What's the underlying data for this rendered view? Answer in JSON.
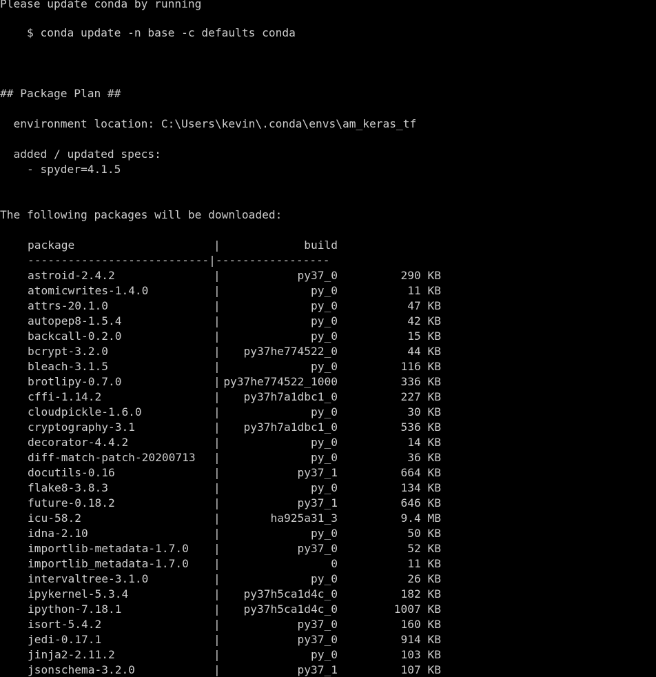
{
  "terminal": {
    "intro": "Please update conda by running",
    "update_command": "    $ conda update -n base -c defaults conda",
    "plan_heading": "## Package Plan ##",
    "env_location": "  environment location: C:\\Users\\kevin\\.conda\\envs\\am_keras_tf",
    "specs_heading": "  added / updated specs:",
    "spec_item": "    - spyder=4.1.5",
    "download_heading": "The following packages will be downloaded:",
    "table": {
      "header_package": "package",
      "header_sep": "|",
      "header_build": "build",
      "divider": "---------------------------|-----------------"
    },
    "packages": [
      {
        "name": "astroid-2.4.2",
        "build": "py37_0",
        "size": "290 KB"
      },
      {
        "name": "atomicwrites-1.4.0",
        "build": "py_0",
        "size": "11 KB"
      },
      {
        "name": "attrs-20.1.0",
        "build": "py_0",
        "size": "47 KB"
      },
      {
        "name": "autopep8-1.5.4",
        "build": "py_0",
        "size": "42 KB"
      },
      {
        "name": "backcall-0.2.0",
        "build": "py_0",
        "size": "15 KB"
      },
      {
        "name": "bcrypt-3.2.0",
        "build": "py37he774522_0",
        "size": "44 KB"
      },
      {
        "name": "bleach-3.1.5",
        "build": "py_0",
        "size": "116 KB"
      },
      {
        "name": "brotlipy-0.7.0",
        "build": "py37he774522_1000",
        "size": "336 KB"
      },
      {
        "name": "cffi-1.14.2",
        "build": "py37h7a1dbc1_0",
        "size": "227 KB"
      },
      {
        "name": "cloudpickle-1.6.0",
        "build": "py_0",
        "size": "30 KB"
      },
      {
        "name": "cryptography-3.1",
        "build": "py37h7a1dbc1_0",
        "size": "536 KB"
      },
      {
        "name": "decorator-4.4.2",
        "build": "py_0",
        "size": "14 KB"
      },
      {
        "name": "diff-match-patch-20200713",
        "build": "py_0",
        "size": "36 KB"
      },
      {
        "name": "docutils-0.16",
        "build": "py37_1",
        "size": "664 KB"
      },
      {
        "name": "flake8-3.8.3",
        "build": "py_0",
        "size": "134 KB"
      },
      {
        "name": "future-0.18.2",
        "build": "py37_1",
        "size": "646 KB"
      },
      {
        "name": "icu-58.2",
        "build": "ha925a31_3",
        "size": "9.4 MB"
      },
      {
        "name": "idna-2.10",
        "build": "py_0",
        "size": "50 KB"
      },
      {
        "name": "importlib-metadata-1.7.0",
        "build": "py37_0",
        "size": "52 KB"
      },
      {
        "name": "importlib_metadata-1.7.0",
        "build": "0",
        "size": "11 KB"
      },
      {
        "name": "intervaltree-3.1.0",
        "build": "py_0",
        "size": "26 KB"
      },
      {
        "name": "ipykernel-5.3.4",
        "build": "py37h5ca1d4c_0",
        "size": "182 KB"
      },
      {
        "name": "ipython-7.18.1",
        "build": "py37h5ca1d4c_0",
        "size": "1007 KB"
      },
      {
        "name": "isort-5.4.2",
        "build": "py37_0",
        "size": "160 KB"
      },
      {
        "name": "jedi-0.17.1",
        "build": "py37_0",
        "size": "914 KB"
      },
      {
        "name": "jinja2-2.11.2",
        "build": "py_0",
        "size": "103 KB"
      },
      {
        "name": "jsonschema-3.2.0",
        "build": "py37_1",
        "size": "107 KB"
      }
    ],
    "colors": {
      "background": "#000000",
      "text": "#cccccc"
    }
  }
}
